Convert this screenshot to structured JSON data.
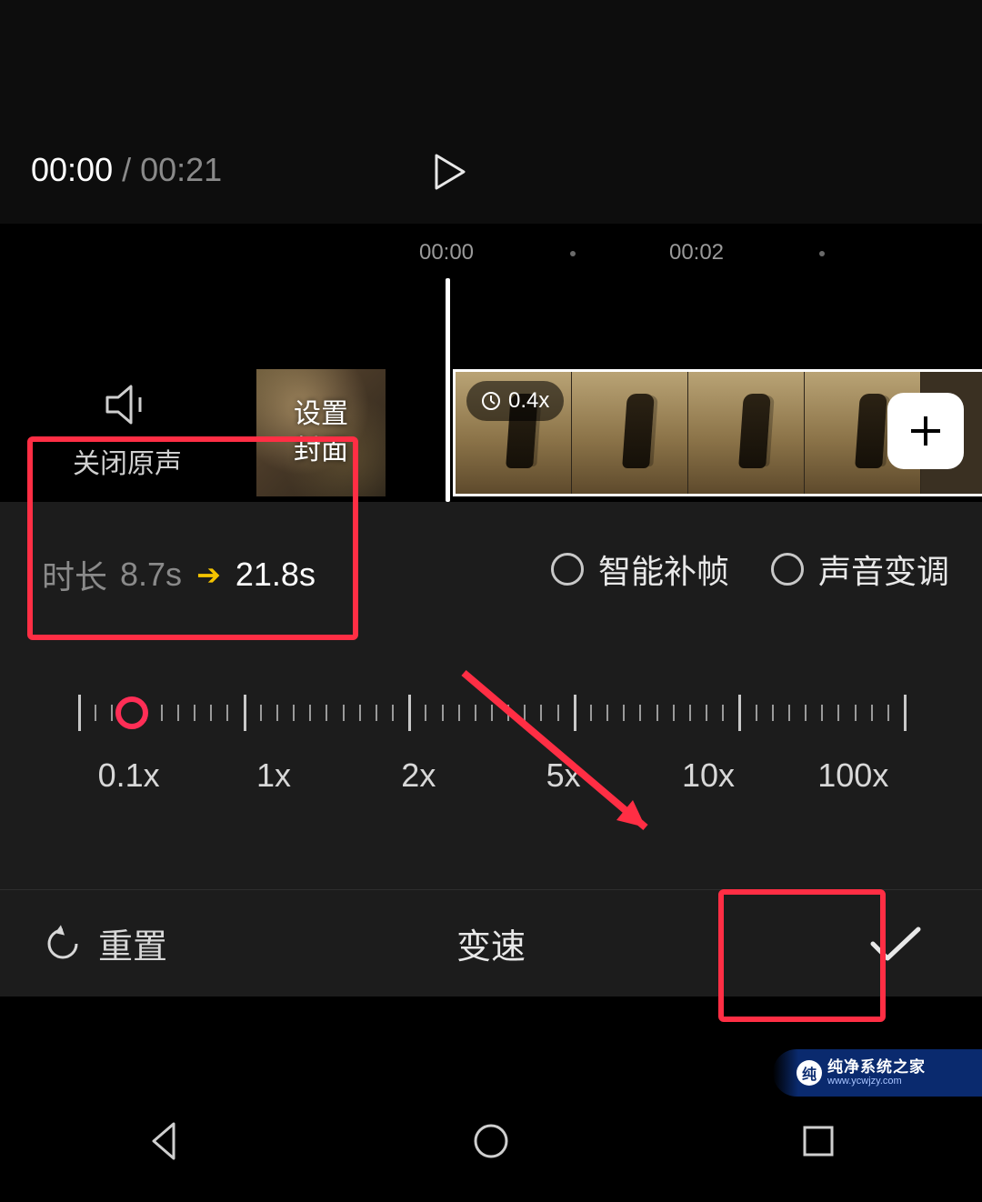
{
  "preview": {
    "current_time": "00:00",
    "separator": "/",
    "total_time": "00:21"
  },
  "ruler": {
    "labels": [
      "00:00",
      "00:02"
    ]
  },
  "left_controls": {
    "mute_label": "关闭原声",
    "cover_label": "设置\n封面"
  },
  "clip": {
    "speed_badge": "0.4x"
  },
  "duration": {
    "label": "时长",
    "original": "8.7s",
    "arrow": "➔",
    "new_value": "21.8s"
  },
  "options": {
    "smart_interpolation": "智能补帧",
    "pitch_shift": "声音变调"
  },
  "speed_slider": {
    "labels": [
      "0.1x",
      "1x",
      "2x",
      "5x",
      "10x",
      "100x"
    ],
    "handle_position_pct": 6.5
  },
  "bottom": {
    "reset": "重置",
    "title": "变速"
  },
  "watermark": {
    "brand": "纯净系统之家",
    "url": "www.ycwjzy.com"
  }
}
